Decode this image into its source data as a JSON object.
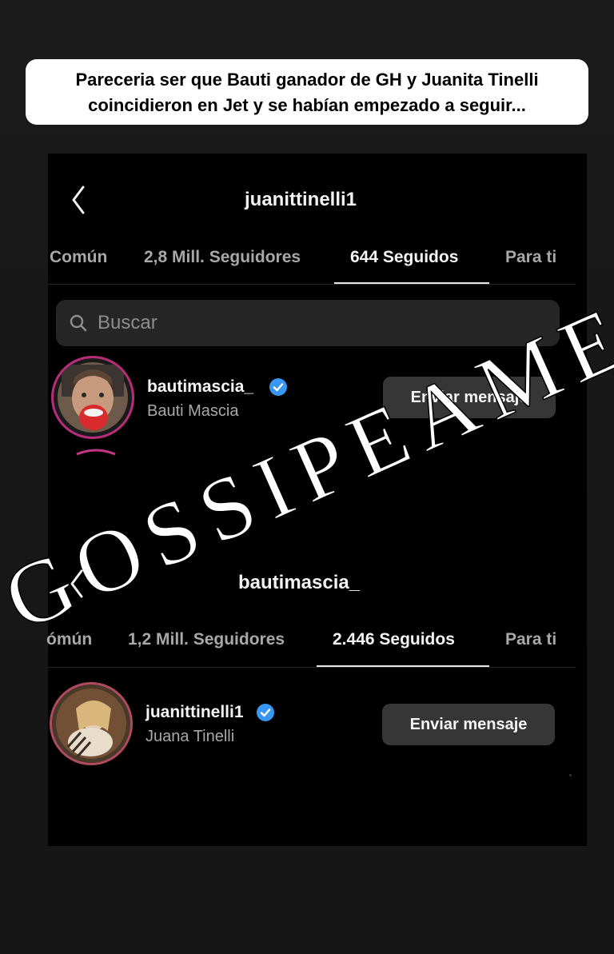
{
  "caption": {
    "line1": "Pareceria ser que Bauti ganador de GH y Juanita Tinelli",
    "line2": "coincidieron en Jet y se habían empezado a seguir..."
  },
  "watermark": "GOSSIPEAME",
  "top_profile": {
    "header_title": "juanittinelli1",
    "tabs": [
      {
        "label": "Común"
      },
      {
        "label": "2,8 Mill. Seguidores"
      },
      {
        "label": "644 Seguidos"
      },
      {
        "label": "Para ti"
      }
    ],
    "search_placeholder": "Buscar",
    "result": {
      "username": "bautimascia_",
      "full_name": "Bauti Mascia",
      "button": "Enviar mensaje"
    }
  },
  "bottom_profile": {
    "header_title": "bautimascia_",
    "tabs": [
      {
        "label": "ómún"
      },
      {
        "label": "1,2 Mill. Seguidores"
      },
      {
        "label": "2.446 Seguidos"
      },
      {
        "label": "Para ti"
      }
    ],
    "result": {
      "username": "juanittinelli1",
      "full_name": "Juana Tinelli",
      "button": "Enviar mensaje"
    }
  },
  "colors": {
    "verified": "#3897f0",
    "story_ring": "#c13584",
    "button_bg": "#363636"
  },
  "icons": [
    "back-arrow-icon",
    "search-icon",
    "verified-badge-icon"
  ]
}
